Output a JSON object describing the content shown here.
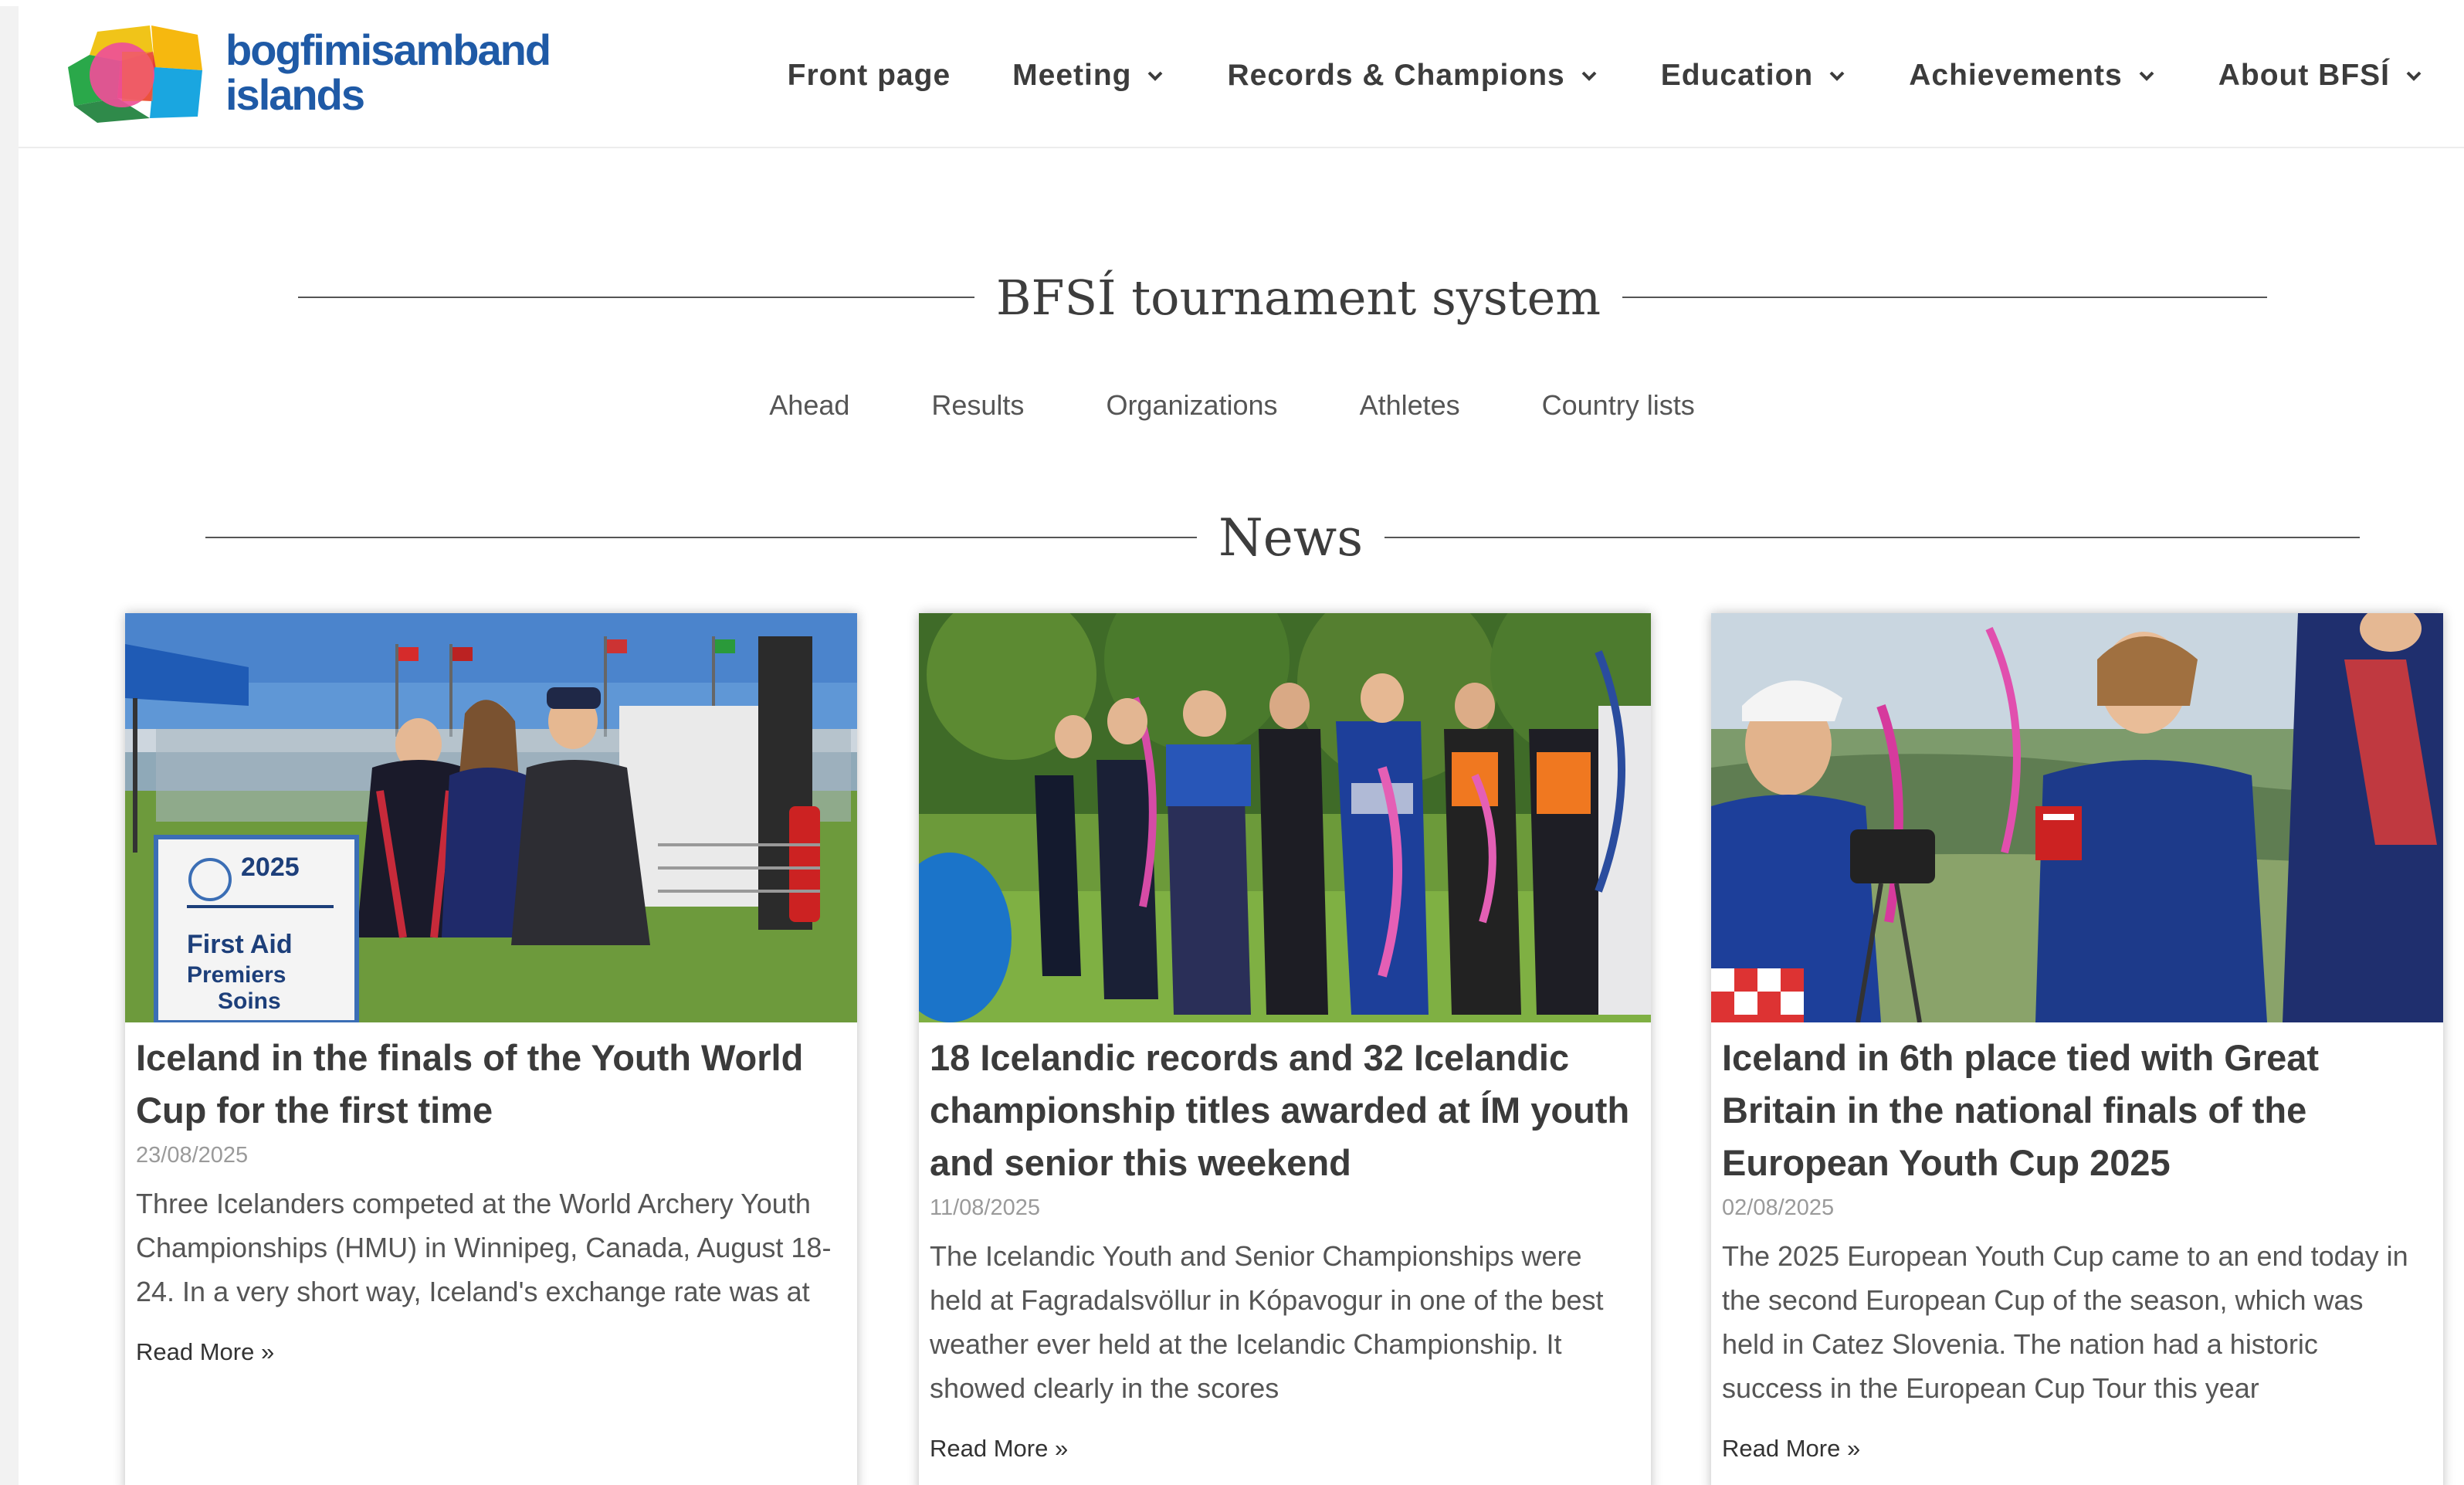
{
  "brand": {
    "line1": "bogfimisamband",
    "line2": "islands"
  },
  "nav": {
    "items": [
      {
        "label": "Front page",
        "dropdown": false
      },
      {
        "label": "Meeting",
        "dropdown": true
      },
      {
        "label": "Records & Champions",
        "dropdown": true
      },
      {
        "label": "Education",
        "dropdown": true
      },
      {
        "label": "Achievements",
        "dropdown": true
      },
      {
        "label": "About BFSÍ",
        "dropdown": true
      }
    ]
  },
  "tournament": {
    "title": "BFSÍ tournament system",
    "links": [
      "Ahead",
      "Results",
      "Organizations",
      "Athletes",
      "Country lists"
    ]
  },
  "news": {
    "title": "News",
    "read_more": "Read More »",
    "posts": [
      {
        "title": "Iceland in the finals of the Youth World Cup for the first time",
        "date": "23/08/2025",
        "excerpt": "Three Icelanders competed at the World Archery Youth Championships (HMU) in Winnipeg, Canada, August 18-24. In a very short way, Iceland's exchange rate was at",
        "image_sign": {
          "year": "2025",
          "line1": "First Aid",
          "line2": "Premiers",
          "line3": "Soins"
        }
      },
      {
        "title": "18 Icelandic records and 32 Icelandic championship titles awarded at ÍM youth and senior this weekend",
        "date": "11/08/2025",
        "excerpt": "The Icelandic Youth and Senior Championships were held at Fagradalsvöllur in Kópavogur in one of the best weather ever held at the Icelandic Championship. It showed clearly in the scores"
      },
      {
        "title": "Iceland in 6th place tied with Great Britain in the national finals of the European Youth Cup 2025",
        "date": "02/08/2025",
        "excerpt": "The 2025 European Youth Cup came to an end today in the second European Cup of the season, which was held in Catez Slovenia. The nation had a historic success in the European Cup Tour this year"
      }
    ]
  },
  "colors": {
    "brand_blue": "#1f5aa6",
    "nav_text": "#3c3c3c",
    "date_gray": "#9a9a9a"
  }
}
